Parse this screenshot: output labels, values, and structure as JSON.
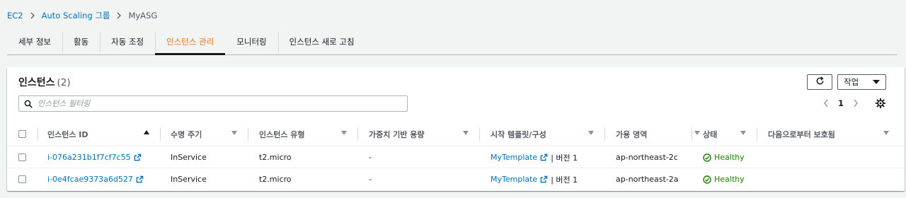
{
  "breadcrumb": {
    "items": [
      "EC2",
      "Auto Scaling 그룹"
    ],
    "current": "MyASG"
  },
  "tabs": [
    {
      "label": "세부 정보",
      "active": false
    },
    {
      "label": "활동",
      "active": false
    },
    {
      "label": "자동 조정",
      "active": false
    },
    {
      "label": "인스턴스 관리",
      "active": true
    },
    {
      "label": "모니터링",
      "active": false
    },
    {
      "label": "인스턴스 새로 고침",
      "active": false
    }
  ],
  "panel": {
    "title": "인스턴스",
    "count": "(2)",
    "actions_label": "작업",
    "refresh_icon": "refresh-icon"
  },
  "filter": {
    "placeholder": "인스턴스 필터링",
    "icon": "search-icon"
  },
  "pagination": {
    "current_page": "1"
  },
  "table": {
    "columns": [
      "인스턴스 ID",
      "수명 주기",
      "인스턴스 유형",
      "가중치 기반 용량",
      "시작 템플릿/구성",
      "가용 영역",
      "상태",
      "다음으로부터 보호됨"
    ],
    "sorted_column": "인스턴스 ID",
    "sort_direction": "ascending",
    "rows": [
      {
        "id": "i-076a231b1f7cf7c55",
        "lifecycle": "InService",
        "type": "t2.micro",
        "weight": "-",
        "template": "MyTemplate",
        "version": "| 버전 1",
        "az": "ap-northeast-2c",
        "health": "Healthy",
        "protected": ""
      },
      {
        "id": "i-0e4fcae9373a6d527",
        "lifecycle": "InService",
        "type": "t2.micro",
        "weight": "-",
        "template": "MyTemplate",
        "version": "| 버전 1",
        "az": "ap-northeast-2a",
        "health": "Healthy",
        "protected": ""
      }
    ]
  },
  "colors": {
    "link": "#0073bb",
    "active_tab": "#ec7211",
    "healthy": "#1d8102"
  }
}
